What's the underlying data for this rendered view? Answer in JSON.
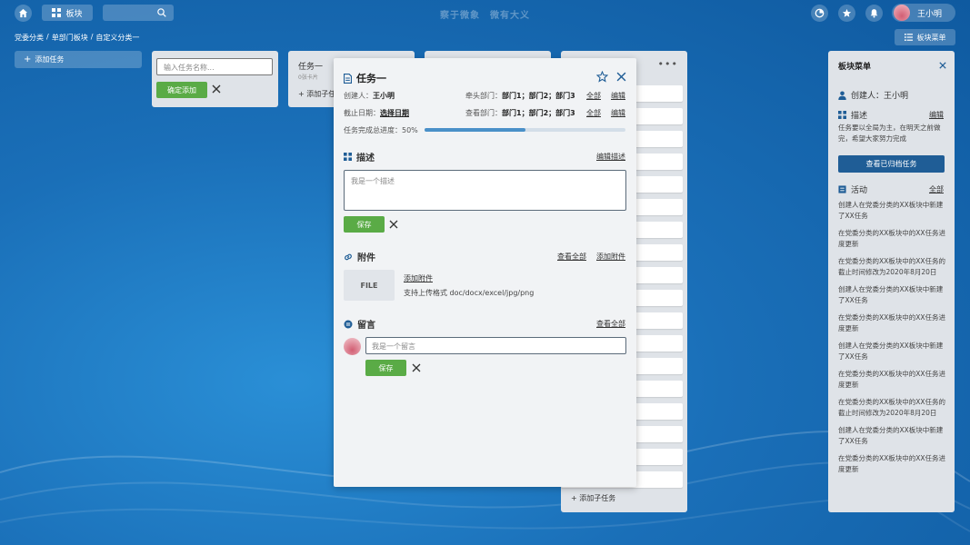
{
  "topbar": {
    "board_label": "板块",
    "slogan": "察于微象　微有大义",
    "user_name": "王小明"
  },
  "breadcrumb": [
    "党委分类",
    "/",
    "单部门板块",
    "/",
    "自定义分类一"
  ],
  "board_menu_button": "板块菜单",
  "add_task_label": "添加任务",
  "new_list": {
    "placeholder": "输入任务名称...",
    "confirm_label": "确定添加"
  },
  "list2": {
    "title": "任务一",
    "card_count": "0张卡片",
    "add_sub_label": "添加子任务"
  },
  "list4": {
    "add_sub_label": "添加子任务"
  },
  "modal": {
    "title": "任务一",
    "creator_label": "创建人：",
    "creator": "王小明",
    "lead_dept_label": "牵头部门：",
    "lead_depts": "部门1；部门2；部门3",
    "lead_all": "全部",
    "lead_edit": "编辑",
    "due_label": "截止日期：",
    "due_value": "选择日期",
    "view_dept_label": "查看部门：",
    "view_depts": "部门1；部门2；部门3",
    "view_all": "全部",
    "view_edit": "编辑",
    "progress_label": "任务完成总进度：",
    "progress_text": "50%",
    "progress_value": 0.5,
    "description": {
      "title": "描述",
      "edit_link": "编辑描述",
      "placeholder": "我是一个描述",
      "save_label": "保存"
    },
    "attachments": {
      "title": "附件",
      "view_all": "查看全部",
      "add_link": "添加附件",
      "file_label": "FILE",
      "add_attachment": "添加附件",
      "formats": "支持上传格式 doc/docx/excel/jpg/png"
    },
    "comments": {
      "title": "留言",
      "view_all": "查看全部",
      "placeholder": "我是一个留言",
      "save_label": "保存"
    }
  },
  "side_menu": {
    "title": "板块菜单",
    "creator": "创建人：王小明",
    "desc_title": "描述",
    "desc_edit": "编辑",
    "desc_text": "任务要以全局为主，在明天之前做完，希望大家努力完成",
    "archive_button": "查看已归档任务",
    "activity_title": "活动",
    "activity_all": "全部",
    "activities": [
      "创建人在党委分类的XX板块中新建了XX任务",
      "在党委分类的XX板块中的XX任务进度更新",
      "在党委分类的XX板块中的XX任务的截止时间修改为2020年8月20日",
      "创建人在党委分类的XX板块中新建了XX任务",
      "在党委分类的XX板块中的XX任务进度更新",
      "创建人在党委分类的XX板块中新建了XX任务",
      "在党委分类的XX板块中的XX任务进度更新",
      "在党委分类的XX板块中的XX任务的截止时间修改为2020年8月20日",
      "创建人在党委分类的XX板块中新建了XX任务",
      "在党委分类的XX板块中的XX任务进度更新"
    ]
  },
  "colors": {
    "accent_green": "#5aab46",
    "accent_blue": "#1f5d96",
    "progress_blue": "#4a90c8"
  }
}
